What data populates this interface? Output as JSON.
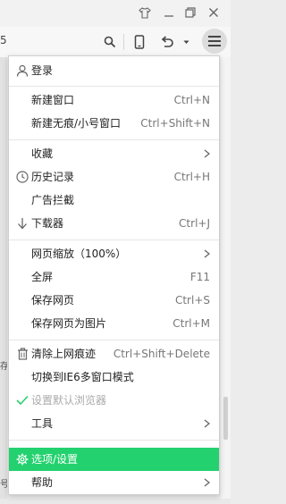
{
  "window": {
    "buttons": [
      "skin-icon",
      "minimize-icon",
      "restore-icon",
      "close-icon"
    ]
  },
  "toolbar": {
    "right_edge_char": "5",
    "icons": [
      "search-icon",
      "mobile-icon",
      "undo-icon",
      "dropdown-icon",
      "menu-icon"
    ]
  },
  "page_edge": {
    "left_char_1": "存",
    "left_char_2": "号"
  },
  "menu": {
    "login": {
      "label": "登录"
    },
    "new_window": {
      "label": "新建窗口",
      "shortcut": "Ctrl+N"
    },
    "new_private_window": {
      "label": "新建无痕/小号窗口",
      "shortcut": "Ctrl+Shift+N"
    },
    "favorites": {
      "label": "收藏"
    },
    "history": {
      "label": "历史记录",
      "shortcut": "Ctrl+H"
    },
    "ad_block": {
      "label": "广告拦截"
    },
    "downloads": {
      "label": "下载器",
      "shortcut": "Ctrl+J"
    },
    "zoom": {
      "label": "网页缩放（100%）"
    },
    "fullscreen": {
      "label": "全屏",
      "shortcut": "F11"
    },
    "save_page": {
      "label": "保存网页",
      "shortcut": "Ctrl+S"
    },
    "save_as_image": {
      "label": "保存网页为图片",
      "shortcut": "Ctrl+M"
    },
    "clear_traces": {
      "label": "清除上网痕迹",
      "shortcut": "Ctrl+Shift+Delete"
    },
    "ie6_mode": {
      "label": "切换到IE6多窗口模式"
    },
    "set_default": {
      "label": "设置默认浏览器"
    },
    "tools": {
      "label": "工具"
    },
    "settings": {
      "label": "选项/设置"
    },
    "help": {
      "label": "帮助"
    }
  },
  "colors": {
    "highlight": "#23d16e",
    "check": "#2ecc71"
  }
}
